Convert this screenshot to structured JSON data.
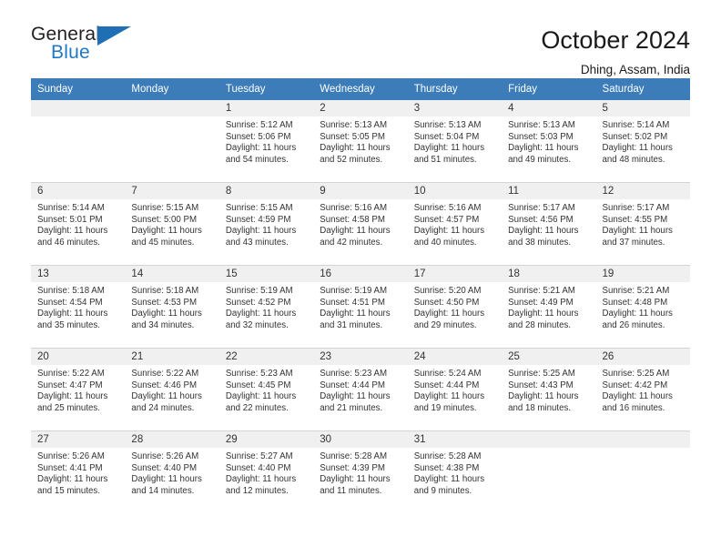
{
  "brand": {
    "line1": "General",
    "line2": "Blue",
    "triangle_color": "#1f6fb5",
    "blue_text_color": "#1f78c1"
  },
  "header": {
    "title": "October 2024",
    "subtitle": "Dhing, Assam, India",
    "header_bg": "#3b7cb9",
    "daynum_bg": "#f0f0f0"
  },
  "weekday_headers": [
    "Sunday",
    "Monday",
    "Tuesday",
    "Wednesday",
    "Thursday",
    "Friday",
    "Saturday"
  ],
  "labels": {
    "sunrise_prefix": "Sunrise:",
    "sunset_prefix": "Sunset:",
    "daylight_prefix": "Daylight:"
  },
  "weeks": [
    [
      {
        "day": "",
        "sunrise": "",
        "sunset": "",
        "daylight_line1": "",
        "daylight_line2": ""
      },
      {
        "day": "",
        "sunrise": "",
        "sunset": "",
        "daylight_line1": "",
        "daylight_line2": ""
      },
      {
        "day": "1",
        "sunrise": "Sunrise: 5:12 AM",
        "sunset": "Sunset: 5:06 PM",
        "daylight_line1": "Daylight: 11 hours",
        "daylight_line2": "and 54 minutes."
      },
      {
        "day": "2",
        "sunrise": "Sunrise: 5:13 AM",
        "sunset": "Sunset: 5:05 PM",
        "daylight_line1": "Daylight: 11 hours",
        "daylight_line2": "and 52 minutes."
      },
      {
        "day": "3",
        "sunrise": "Sunrise: 5:13 AM",
        "sunset": "Sunset: 5:04 PM",
        "daylight_line1": "Daylight: 11 hours",
        "daylight_line2": "and 51 minutes."
      },
      {
        "day": "4",
        "sunrise": "Sunrise: 5:13 AM",
        "sunset": "Sunset: 5:03 PM",
        "daylight_line1": "Daylight: 11 hours",
        "daylight_line2": "and 49 minutes."
      },
      {
        "day": "5",
        "sunrise": "Sunrise: 5:14 AM",
        "sunset": "Sunset: 5:02 PM",
        "daylight_line1": "Daylight: 11 hours",
        "daylight_line2": "and 48 minutes."
      }
    ],
    [
      {
        "day": "6",
        "sunrise": "Sunrise: 5:14 AM",
        "sunset": "Sunset: 5:01 PM",
        "daylight_line1": "Daylight: 11 hours",
        "daylight_line2": "and 46 minutes."
      },
      {
        "day": "7",
        "sunrise": "Sunrise: 5:15 AM",
        "sunset": "Sunset: 5:00 PM",
        "daylight_line1": "Daylight: 11 hours",
        "daylight_line2": "and 45 minutes."
      },
      {
        "day": "8",
        "sunrise": "Sunrise: 5:15 AM",
        "sunset": "Sunset: 4:59 PM",
        "daylight_line1": "Daylight: 11 hours",
        "daylight_line2": "and 43 minutes."
      },
      {
        "day": "9",
        "sunrise": "Sunrise: 5:16 AM",
        "sunset": "Sunset: 4:58 PM",
        "daylight_line1": "Daylight: 11 hours",
        "daylight_line2": "and 42 minutes."
      },
      {
        "day": "10",
        "sunrise": "Sunrise: 5:16 AM",
        "sunset": "Sunset: 4:57 PM",
        "daylight_line1": "Daylight: 11 hours",
        "daylight_line2": "and 40 minutes."
      },
      {
        "day": "11",
        "sunrise": "Sunrise: 5:17 AM",
        "sunset": "Sunset: 4:56 PM",
        "daylight_line1": "Daylight: 11 hours",
        "daylight_line2": "and 38 minutes."
      },
      {
        "day": "12",
        "sunrise": "Sunrise: 5:17 AM",
        "sunset": "Sunset: 4:55 PM",
        "daylight_line1": "Daylight: 11 hours",
        "daylight_line2": "and 37 minutes."
      }
    ],
    [
      {
        "day": "13",
        "sunrise": "Sunrise: 5:18 AM",
        "sunset": "Sunset: 4:54 PM",
        "daylight_line1": "Daylight: 11 hours",
        "daylight_line2": "and 35 minutes."
      },
      {
        "day": "14",
        "sunrise": "Sunrise: 5:18 AM",
        "sunset": "Sunset: 4:53 PM",
        "daylight_line1": "Daylight: 11 hours",
        "daylight_line2": "and 34 minutes."
      },
      {
        "day": "15",
        "sunrise": "Sunrise: 5:19 AM",
        "sunset": "Sunset: 4:52 PM",
        "daylight_line1": "Daylight: 11 hours",
        "daylight_line2": "and 32 minutes."
      },
      {
        "day": "16",
        "sunrise": "Sunrise: 5:19 AM",
        "sunset": "Sunset: 4:51 PM",
        "daylight_line1": "Daylight: 11 hours",
        "daylight_line2": "and 31 minutes."
      },
      {
        "day": "17",
        "sunrise": "Sunrise: 5:20 AM",
        "sunset": "Sunset: 4:50 PM",
        "daylight_line1": "Daylight: 11 hours",
        "daylight_line2": "and 29 minutes."
      },
      {
        "day": "18",
        "sunrise": "Sunrise: 5:21 AM",
        "sunset": "Sunset: 4:49 PM",
        "daylight_line1": "Daylight: 11 hours",
        "daylight_line2": "and 28 minutes."
      },
      {
        "day": "19",
        "sunrise": "Sunrise: 5:21 AM",
        "sunset": "Sunset: 4:48 PM",
        "daylight_line1": "Daylight: 11 hours",
        "daylight_line2": "and 26 minutes."
      }
    ],
    [
      {
        "day": "20",
        "sunrise": "Sunrise: 5:22 AM",
        "sunset": "Sunset: 4:47 PM",
        "daylight_line1": "Daylight: 11 hours",
        "daylight_line2": "and 25 minutes."
      },
      {
        "day": "21",
        "sunrise": "Sunrise: 5:22 AM",
        "sunset": "Sunset: 4:46 PM",
        "daylight_line1": "Daylight: 11 hours",
        "daylight_line2": "and 24 minutes."
      },
      {
        "day": "22",
        "sunrise": "Sunrise: 5:23 AM",
        "sunset": "Sunset: 4:45 PM",
        "daylight_line1": "Daylight: 11 hours",
        "daylight_line2": "and 22 minutes."
      },
      {
        "day": "23",
        "sunrise": "Sunrise: 5:23 AM",
        "sunset": "Sunset: 4:44 PM",
        "daylight_line1": "Daylight: 11 hours",
        "daylight_line2": "and 21 minutes."
      },
      {
        "day": "24",
        "sunrise": "Sunrise: 5:24 AM",
        "sunset": "Sunset: 4:44 PM",
        "daylight_line1": "Daylight: 11 hours",
        "daylight_line2": "and 19 minutes."
      },
      {
        "day": "25",
        "sunrise": "Sunrise: 5:25 AM",
        "sunset": "Sunset: 4:43 PM",
        "daylight_line1": "Daylight: 11 hours",
        "daylight_line2": "and 18 minutes."
      },
      {
        "day": "26",
        "sunrise": "Sunrise: 5:25 AM",
        "sunset": "Sunset: 4:42 PM",
        "daylight_line1": "Daylight: 11 hours",
        "daylight_line2": "and 16 minutes."
      }
    ],
    [
      {
        "day": "27",
        "sunrise": "Sunrise: 5:26 AM",
        "sunset": "Sunset: 4:41 PM",
        "daylight_line1": "Daylight: 11 hours",
        "daylight_line2": "and 15 minutes."
      },
      {
        "day": "28",
        "sunrise": "Sunrise: 5:26 AM",
        "sunset": "Sunset: 4:40 PM",
        "daylight_line1": "Daylight: 11 hours",
        "daylight_line2": "and 14 minutes."
      },
      {
        "day": "29",
        "sunrise": "Sunrise: 5:27 AM",
        "sunset": "Sunset: 4:40 PM",
        "daylight_line1": "Daylight: 11 hours",
        "daylight_line2": "and 12 minutes."
      },
      {
        "day": "30",
        "sunrise": "Sunrise: 5:28 AM",
        "sunset": "Sunset: 4:39 PM",
        "daylight_line1": "Daylight: 11 hours",
        "daylight_line2": "and 11 minutes."
      },
      {
        "day": "31",
        "sunrise": "Sunrise: 5:28 AM",
        "sunset": "Sunset: 4:38 PM",
        "daylight_line1": "Daylight: 11 hours",
        "daylight_line2": "and 9 minutes."
      },
      {
        "day": "",
        "sunrise": "",
        "sunset": "",
        "daylight_line1": "",
        "daylight_line2": ""
      },
      {
        "day": "",
        "sunrise": "",
        "sunset": "",
        "daylight_line1": "",
        "daylight_line2": ""
      }
    ]
  ]
}
